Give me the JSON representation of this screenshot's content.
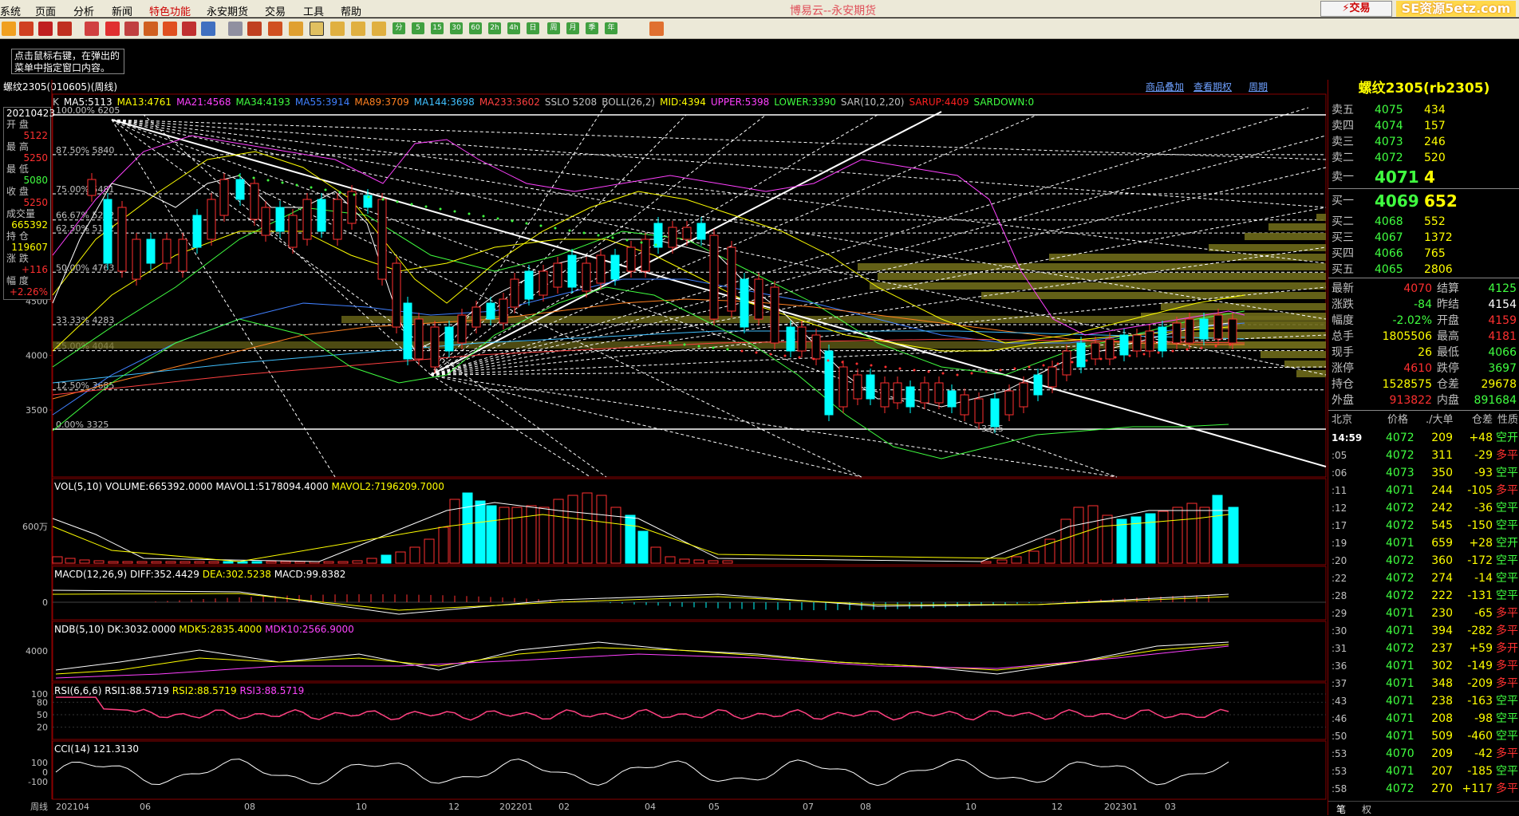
{
  "menu": {
    "items": [
      "系统",
      "页面",
      "分析",
      "新闻",
      "特色功能",
      "永安期货",
      "交易",
      "工具",
      "帮助"
    ],
    "title": "博易云--永安期货",
    "trade": "⚡交易",
    "watermark": "SE资源5etz.com"
  },
  "toolbar": {
    "periods": [
      "分",
      "5",
      "15",
      "30",
      "60",
      "2h",
      "4h",
      "日",
      "周",
      "月",
      "季",
      "年"
    ]
  },
  "hint": "点击鼠标右键，在弹出的菜单中指定窗口内容。",
  "chart_title": "螺纹2305(010605)(周线)",
  "links": {
    "overlay": "商品叠加",
    "options": "查看期权",
    "period": "周期"
  },
  "legend": [
    {
      "t": "K",
      "c": "#c0c0c0"
    },
    {
      "t": "MA5:5113",
      "c": "#ffffff"
    },
    {
      "t": "MA13:4761",
      "c": "#ffff00"
    },
    {
      "t": "MA21:4568",
      "c": "#ff40ff"
    },
    {
      "t": "MA34:4193",
      "c": "#40ff40"
    },
    {
      "t": "MA55:3914",
      "c": "#4080ff"
    },
    {
      "t": "MA89:3709",
      "c": "#ff8020"
    },
    {
      "t": "MA144:3698",
      "c": "#40c0ff"
    },
    {
      "t": "MA233:3602",
      "c": "#ff4040"
    },
    {
      "t": "SSLO 5208",
      "c": "#c0c0c0"
    },
    {
      "t": "BOLL(26,2)",
      "c": "#c0c0c0"
    },
    {
      "t": "MID:4394",
      "c": "#ffff00"
    },
    {
      "t": "UPPER:5398",
      "c": "#ff40ff"
    },
    {
      "t": "LOWER:3390",
      "c": "#40ff40"
    },
    {
      "t": "SAR(10,2,20)",
      "c": "#c0c0c0"
    },
    {
      "t": "SARUP:4409",
      "c": "#ff2020"
    },
    {
      "t": "SARDOWN:0",
      "c": "#40ff40"
    }
  ],
  "info": [
    {
      "l": "20210423",
      "v": ""
    },
    {
      "l": "开  盘",
      "v": "5122"
    },
    {
      "l": "最  高",
      "v": "5250"
    },
    {
      "l": "最  低",
      "v": "5080"
    },
    {
      "l": "收  盘",
      "v": "5250"
    },
    {
      "l": "成交量",
      "v": "665392"
    },
    {
      "l": "持  仓",
      "v": "119607"
    },
    {
      "l": "涨  跌",
      "v": "+116"
    },
    {
      "l": "幅  度",
      "v": "+2.26%"
    }
  ],
  "fib": [
    {
      "l": "100.00%",
      "v": "6205"
    },
    {
      "l": "87.50%",
      "v": "5840"
    },
    {
      "l": "75.00%",
      "v": "5481"
    },
    {
      "l": "66.67%",
      "v": "5242"
    },
    {
      "l": "62.50%",
      "v": "5122"
    },
    {
      "l": "50.00%",
      "v": "4763"
    },
    {
      "l": "33.33%",
      "v": "4283"
    },
    {
      "l": "25.00%",
      "v": "4044"
    },
    {
      "l": "12.50%",
      "v": "3685"
    },
    {
      "l": "0.00%",
      "v": "3325"
    }
  ],
  "main_y": [
    "4500",
    "4000",
    "3500"
  ],
  "low_label": "3325",
  "vol": {
    "label": "VOL(5,10) VOLUME:665392.0000",
    "mavol1": "MAVOL1:5178094.4000",
    "mavol2": "MAVOL2:7196209.7000",
    "y": "600万"
  },
  "macd": {
    "label": "MACD(12,26,9)",
    "diff": "DIFF:352.4429",
    "dea": "DEA:302.5238",
    "macd": "MACD:99.8382",
    "y": "0"
  },
  "ndb": {
    "label": "NDB(5,10)",
    "dk": "DK:3032.0000",
    "mdk5": "MDK5:2835.4000",
    "mdk10": "MDK10:2566.9000",
    "y": "4000"
  },
  "rsi": {
    "label": "RSI(6,6,6)",
    "r1": "RSI1:88.5719",
    "r2": "RSI2:88.5719",
    "r3": "RSI3:88.5719",
    "y": [
      "100",
      "80",
      "50",
      "20"
    ]
  },
  "cci": {
    "label": "CCI(14)",
    "v": "121.3130",
    "y": [
      "100",
      "0",
      "-100"
    ]
  },
  "xaxis": {
    "label": "周线",
    "ticks": [
      "202104",
      "06",
      "08",
      "10",
      "12",
      "202201",
      "02",
      "04",
      "05",
      "07",
      "08",
      "10",
      "12",
      "202301",
      "03"
    ]
  },
  "quote": {
    "title": "螺纹2305(rb2305)",
    "asks": [
      {
        "n": "卖五",
        "p": "4075",
        "v": "434"
      },
      {
        "n": "卖四",
        "p": "4074",
        "v": "157"
      },
      {
        "n": "卖三",
        "p": "4073",
        "v": "246"
      },
      {
        "n": "卖二",
        "p": "4072",
        "v": "520"
      },
      {
        "n": "卖一",
        "p": "4071",
        "v": "4"
      }
    ],
    "bids": [
      {
        "n": "买一",
        "p": "4069",
        "v": "652"
      },
      {
        "n": "买二",
        "p": "4068",
        "v": "552"
      },
      {
        "n": "买三",
        "p": "4067",
        "v": "1372"
      },
      {
        "n": "买四",
        "p": "4066",
        "v": "765"
      },
      {
        "n": "买五",
        "p": "4065",
        "v": "2806"
      }
    ],
    "stats": [
      {
        "a": "最新",
        "av": "4070",
        "ac": "#ff3030",
        "b": "结算",
        "bv": "4125",
        "bc": "#40ff40"
      },
      {
        "a": "涨跌",
        "av": "-84",
        "ac": "#40ff40",
        "b": "昨结",
        "bv": "4154",
        "bc": "#ffffff"
      },
      {
        "a": "幅度",
        "av": "-2.02%",
        "ac": "#40ff40",
        "b": "开盘",
        "bv": "4159",
        "bc": "#ff3030"
      },
      {
        "a": "总手",
        "av": "1805506",
        "ac": "#ffff00",
        "b": "最高",
        "bv": "4181",
        "bc": "#ff3030"
      },
      {
        "a": "现手",
        "av": "26",
        "ac": "#ffff00",
        "b": "最低",
        "bv": "4066",
        "bc": "#40ff40"
      },
      {
        "a": "涨停",
        "av": "4610",
        "ac": "#ff3030",
        "b": "跌停",
        "bv": "3697",
        "bc": "#40ff40"
      },
      {
        "a": "持仓",
        "av": "1528575",
        "ac": "#ffff00",
        "b": "仓差",
        "bv": "29678",
        "bc": "#ffff00"
      },
      {
        "a": "外盘",
        "av": "913822",
        "ac": "#ff3030",
        "b": "内盘",
        "bv": "891684",
        "bc": "#40ff40"
      }
    ],
    "tick_head": [
      "北京",
      "价格",
      "./大单",
      "仓差",
      "性质"
    ],
    "ticks": [
      {
        "t": "14:59",
        "p": "4072",
        "v": "209",
        "d": "+48",
        "k": "空开"
      },
      {
        "t": ":05",
        "p": "4072",
        "v": "311",
        "d": "-29",
        "k": "多平"
      },
      {
        "t": ":06",
        "p": "4073",
        "v": "350",
        "d": "-93",
        "k": "空平"
      },
      {
        "t": ":11",
        "p": "4071",
        "v": "244",
        "d": "-105",
        "k": "多平"
      },
      {
        "t": ":12",
        "p": "4072",
        "v": "242",
        "d": "-36",
        "k": "空平"
      },
      {
        "t": ":17",
        "p": "4072",
        "v": "545",
        "d": "-150",
        "k": "空平"
      },
      {
        "t": ":19",
        "p": "4071",
        "v": "659",
        "d": "+28",
        "k": "空开"
      },
      {
        "t": ":20",
        "p": "4072",
        "v": "360",
        "d": "-172",
        "k": "空平"
      },
      {
        "t": ":22",
        "p": "4072",
        "v": "274",
        "d": "-14",
        "k": "空平"
      },
      {
        "t": ":28",
        "p": "4072",
        "v": "222",
        "d": "-131",
        "k": "空平"
      },
      {
        "t": ":29",
        "p": "4071",
        "v": "230",
        "d": "-65",
        "k": "多平"
      },
      {
        "t": ":30",
        "p": "4071",
        "v": "394",
        "d": "-282",
        "k": "多平"
      },
      {
        "t": ":31",
        "p": "4072",
        "v": "237",
        "d": "+59",
        "k": "多开"
      },
      {
        "t": ":36",
        "p": "4071",
        "v": "302",
        "d": "-149",
        "k": "多平"
      },
      {
        "t": ":37",
        "p": "4071",
        "v": "348",
        "d": "-209",
        "k": "多平"
      },
      {
        "t": ":43",
        "p": "4071",
        "v": "238",
        "d": "-163",
        "k": "空平"
      },
      {
        "t": ":46",
        "p": "4071",
        "v": "208",
        "d": "-98",
        "k": "空平"
      },
      {
        "t": ":50",
        "p": "4071",
        "v": "509",
        "d": "-460",
        "k": "空平"
      },
      {
        "t": ":53",
        "p": "4070",
        "v": "209",
        "d": "-42",
        "k": "多平"
      },
      {
        "t": ":53",
        "p": "4071",
        "v": "207",
        "d": "-185",
        "k": "空平"
      },
      {
        "t": ":58",
        "p": "4072",
        "v": "270",
        "d": "+117",
        "k": "多平"
      }
    ],
    "tabs": [
      "笔",
      "权"
    ]
  }
}
